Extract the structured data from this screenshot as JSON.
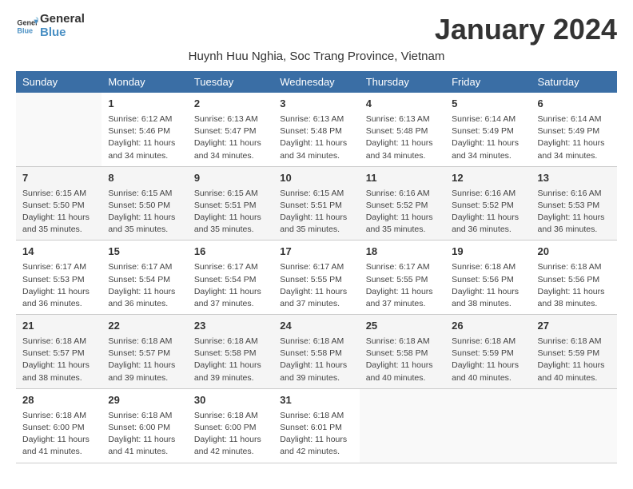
{
  "logo": {
    "line1": "General",
    "line2": "Blue"
  },
  "title": "January 2024",
  "subtitle": "Huynh Huu Nghia, Soc Trang Province, Vietnam",
  "days_header": [
    "Sunday",
    "Monday",
    "Tuesday",
    "Wednesday",
    "Thursday",
    "Friday",
    "Saturday"
  ],
  "weeks": [
    [
      {
        "day": "",
        "info": ""
      },
      {
        "day": "1",
        "info": "Sunrise: 6:12 AM\nSunset: 5:46 PM\nDaylight: 11 hours\nand 34 minutes."
      },
      {
        "day": "2",
        "info": "Sunrise: 6:13 AM\nSunset: 5:47 PM\nDaylight: 11 hours\nand 34 minutes."
      },
      {
        "day": "3",
        "info": "Sunrise: 6:13 AM\nSunset: 5:48 PM\nDaylight: 11 hours\nand 34 minutes."
      },
      {
        "day": "4",
        "info": "Sunrise: 6:13 AM\nSunset: 5:48 PM\nDaylight: 11 hours\nand 34 minutes."
      },
      {
        "day": "5",
        "info": "Sunrise: 6:14 AM\nSunset: 5:49 PM\nDaylight: 11 hours\nand 34 minutes."
      },
      {
        "day": "6",
        "info": "Sunrise: 6:14 AM\nSunset: 5:49 PM\nDaylight: 11 hours\nand 34 minutes."
      }
    ],
    [
      {
        "day": "7",
        "info": "Sunrise: 6:15 AM\nSunset: 5:50 PM\nDaylight: 11 hours\nand 35 minutes."
      },
      {
        "day": "8",
        "info": "Sunrise: 6:15 AM\nSunset: 5:50 PM\nDaylight: 11 hours\nand 35 minutes."
      },
      {
        "day": "9",
        "info": "Sunrise: 6:15 AM\nSunset: 5:51 PM\nDaylight: 11 hours\nand 35 minutes."
      },
      {
        "day": "10",
        "info": "Sunrise: 6:15 AM\nSunset: 5:51 PM\nDaylight: 11 hours\nand 35 minutes."
      },
      {
        "day": "11",
        "info": "Sunrise: 6:16 AM\nSunset: 5:52 PM\nDaylight: 11 hours\nand 35 minutes."
      },
      {
        "day": "12",
        "info": "Sunrise: 6:16 AM\nSunset: 5:52 PM\nDaylight: 11 hours\nand 36 minutes."
      },
      {
        "day": "13",
        "info": "Sunrise: 6:16 AM\nSunset: 5:53 PM\nDaylight: 11 hours\nand 36 minutes."
      }
    ],
    [
      {
        "day": "14",
        "info": "Sunrise: 6:17 AM\nSunset: 5:53 PM\nDaylight: 11 hours\nand 36 minutes."
      },
      {
        "day": "15",
        "info": "Sunrise: 6:17 AM\nSunset: 5:54 PM\nDaylight: 11 hours\nand 36 minutes."
      },
      {
        "day": "16",
        "info": "Sunrise: 6:17 AM\nSunset: 5:54 PM\nDaylight: 11 hours\nand 37 minutes."
      },
      {
        "day": "17",
        "info": "Sunrise: 6:17 AM\nSunset: 5:55 PM\nDaylight: 11 hours\nand 37 minutes."
      },
      {
        "day": "18",
        "info": "Sunrise: 6:17 AM\nSunset: 5:55 PM\nDaylight: 11 hours\nand 37 minutes."
      },
      {
        "day": "19",
        "info": "Sunrise: 6:18 AM\nSunset: 5:56 PM\nDaylight: 11 hours\nand 38 minutes."
      },
      {
        "day": "20",
        "info": "Sunrise: 6:18 AM\nSunset: 5:56 PM\nDaylight: 11 hours\nand 38 minutes."
      }
    ],
    [
      {
        "day": "21",
        "info": "Sunrise: 6:18 AM\nSunset: 5:57 PM\nDaylight: 11 hours\nand 38 minutes."
      },
      {
        "day": "22",
        "info": "Sunrise: 6:18 AM\nSunset: 5:57 PM\nDaylight: 11 hours\nand 39 minutes."
      },
      {
        "day": "23",
        "info": "Sunrise: 6:18 AM\nSunset: 5:58 PM\nDaylight: 11 hours\nand 39 minutes."
      },
      {
        "day": "24",
        "info": "Sunrise: 6:18 AM\nSunset: 5:58 PM\nDaylight: 11 hours\nand 39 minutes."
      },
      {
        "day": "25",
        "info": "Sunrise: 6:18 AM\nSunset: 5:58 PM\nDaylight: 11 hours\nand 40 minutes."
      },
      {
        "day": "26",
        "info": "Sunrise: 6:18 AM\nSunset: 5:59 PM\nDaylight: 11 hours\nand 40 minutes."
      },
      {
        "day": "27",
        "info": "Sunrise: 6:18 AM\nSunset: 5:59 PM\nDaylight: 11 hours\nand 40 minutes."
      }
    ],
    [
      {
        "day": "28",
        "info": "Sunrise: 6:18 AM\nSunset: 6:00 PM\nDaylight: 11 hours\nand 41 minutes."
      },
      {
        "day": "29",
        "info": "Sunrise: 6:18 AM\nSunset: 6:00 PM\nDaylight: 11 hours\nand 41 minutes."
      },
      {
        "day": "30",
        "info": "Sunrise: 6:18 AM\nSunset: 6:00 PM\nDaylight: 11 hours\nand 42 minutes."
      },
      {
        "day": "31",
        "info": "Sunrise: 6:18 AM\nSunset: 6:01 PM\nDaylight: 11 hours\nand 42 minutes."
      },
      {
        "day": "",
        "info": ""
      },
      {
        "day": "",
        "info": ""
      },
      {
        "day": "",
        "info": ""
      }
    ]
  ]
}
